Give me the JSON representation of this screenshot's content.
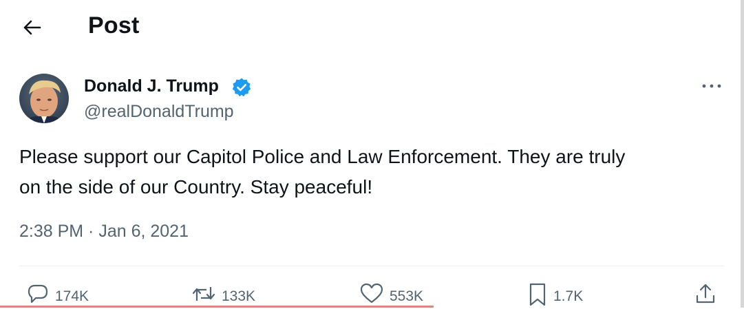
{
  "header": {
    "title": "Post",
    "back_icon": "arrow-left-icon"
  },
  "post": {
    "author_name": "Donald J. Trump",
    "handle": "@realDonaldTrump",
    "verified_icon": "verified-badge-icon",
    "text_lines": [
      "Please support our Capitol Police and Law Enforcement. They are truly",
      "on the side of our Country. Stay peaceful!"
    ],
    "timestamp": "2:38 PM · Jan 6, 2021"
  },
  "actions": {
    "reply_count": "174K",
    "repost_count": "133K",
    "like_count": "553K",
    "bookmark_count": "1.7K"
  },
  "colors": {
    "text": "#0f1419",
    "secondary": "#536471",
    "verified_blue": "#1d9bf0"
  }
}
